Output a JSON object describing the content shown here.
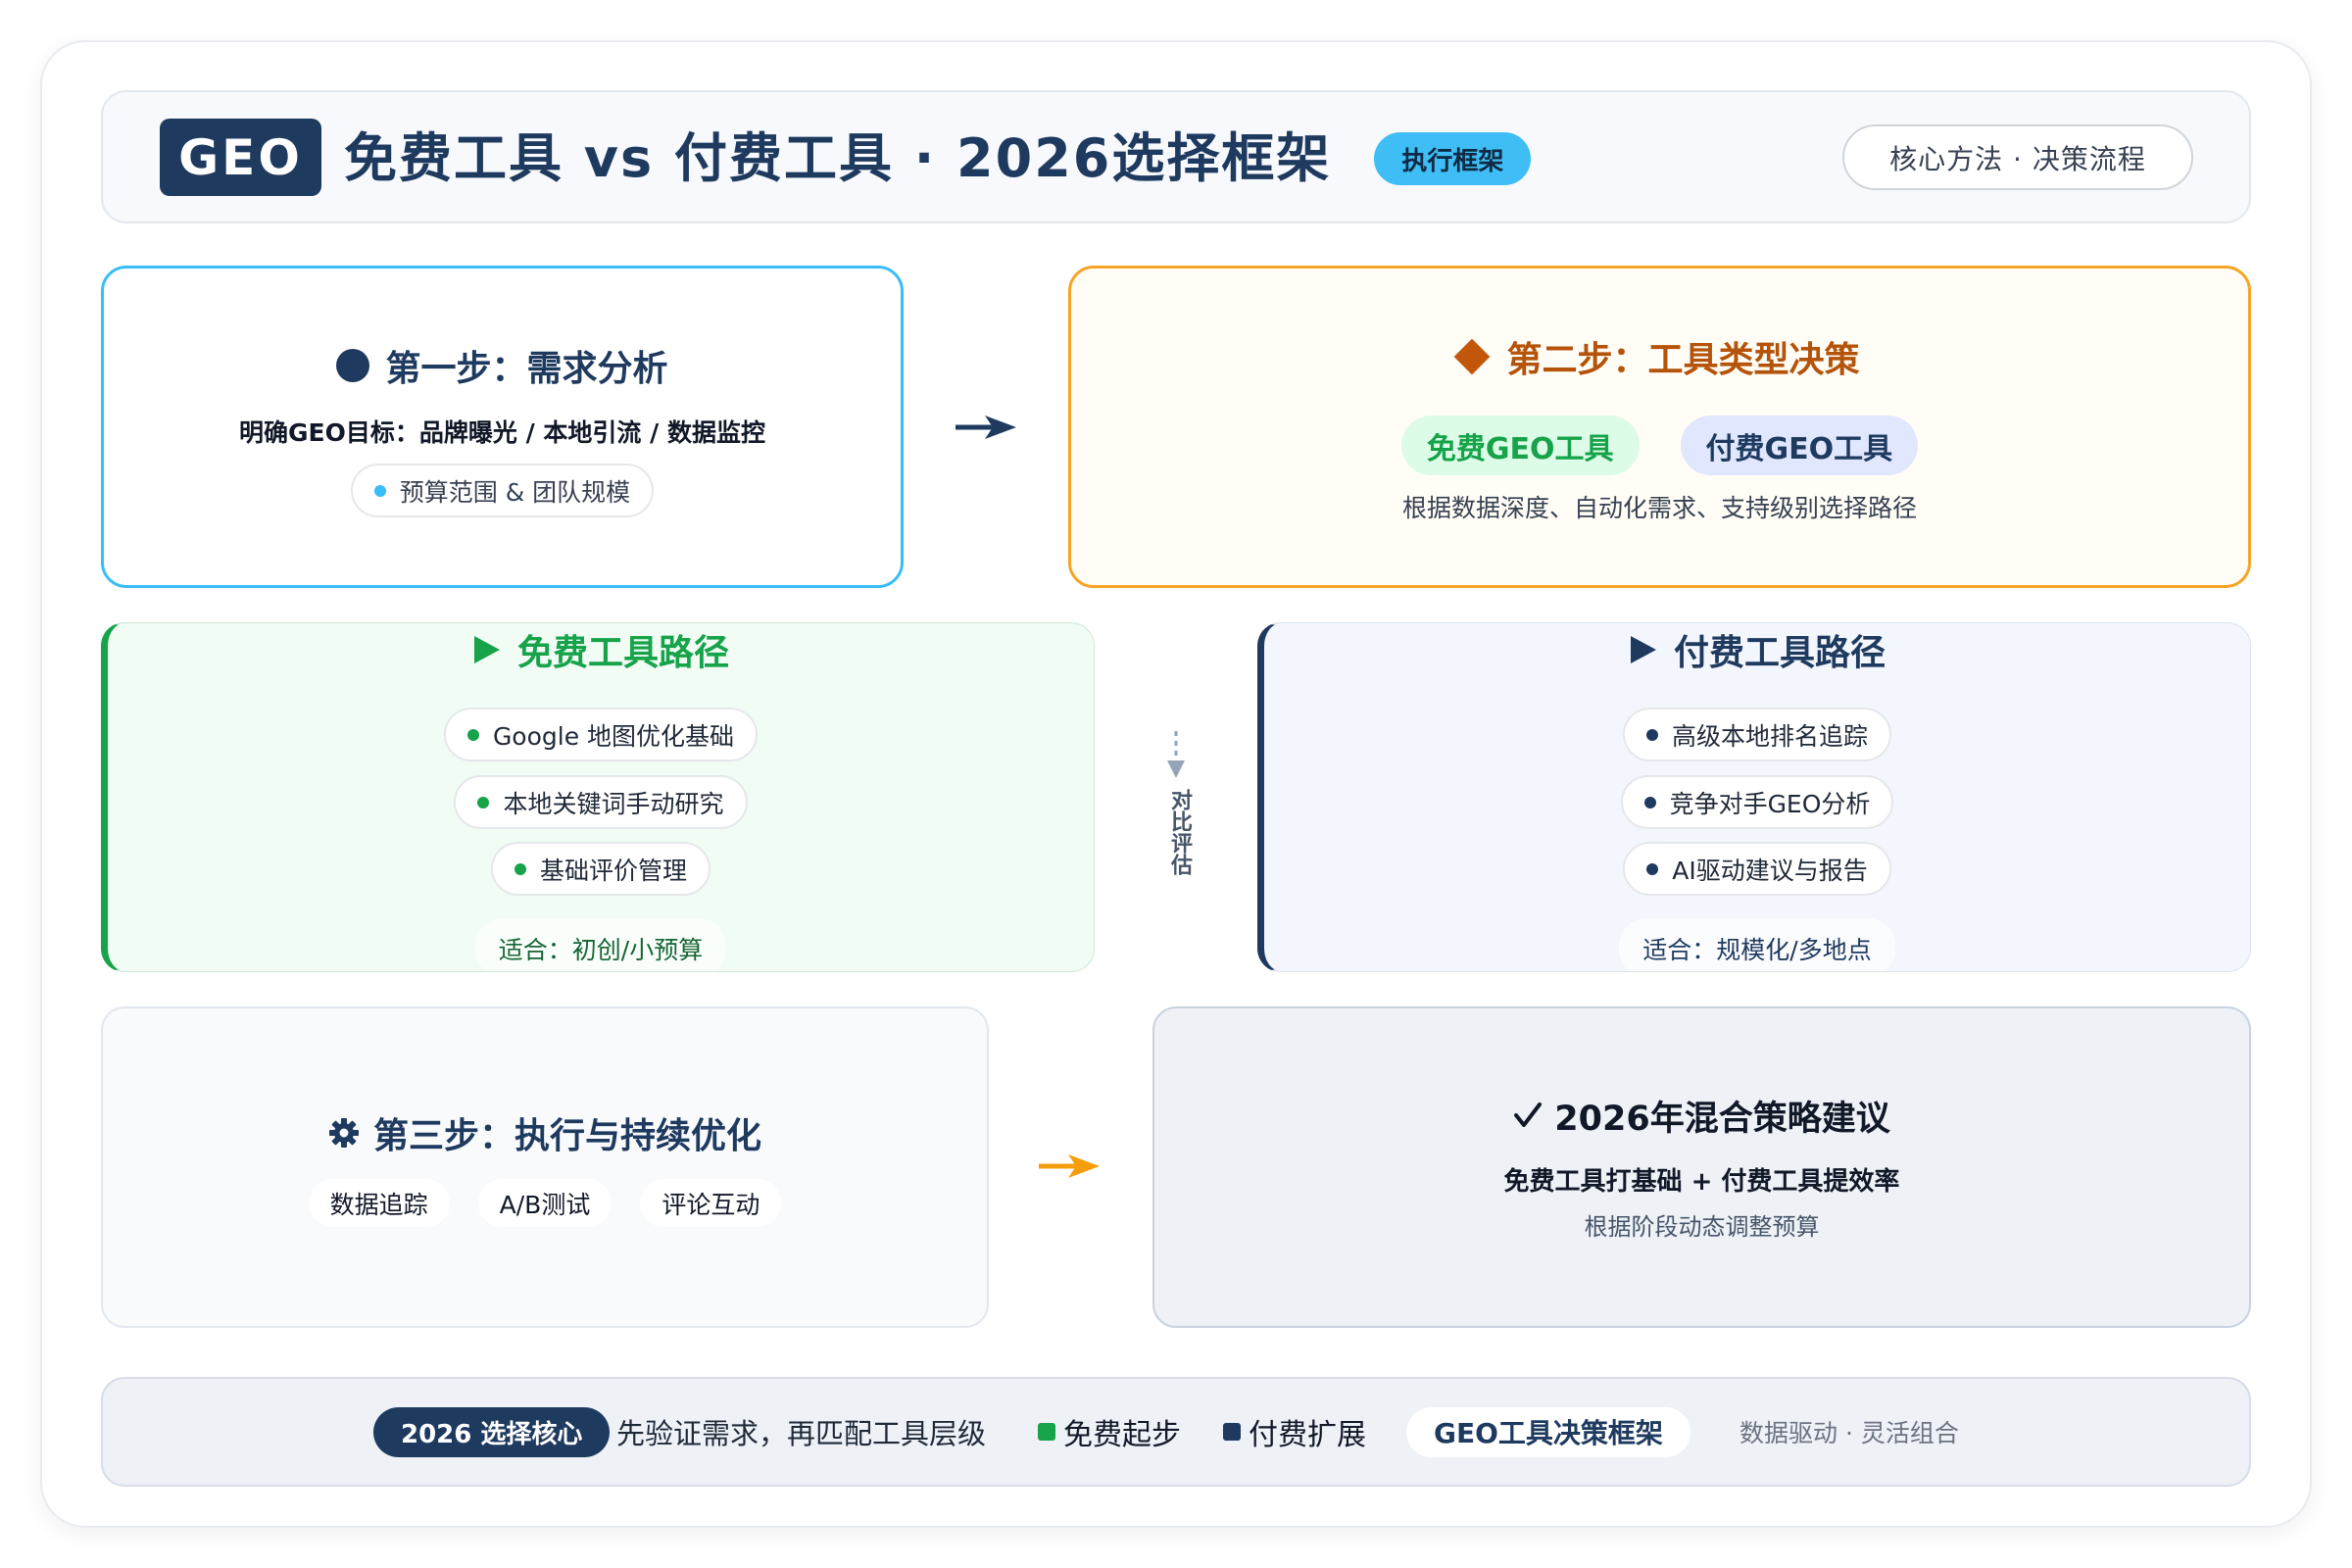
{
  "header": {
    "badge": "GEO",
    "title": "免费工具 vs 付费工具 · 2026选择框架",
    "tag": "执行框架",
    "right_pill": "核心方法 · 决策流程"
  },
  "step1": {
    "icon": "circle-icon",
    "title": "第一步：需求分析",
    "goal": "明确GEO目标：品牌曝光 / 本地引流 / 数据监控",
    "pill": "预算范围 & 团队规模"
  },
  "step2": {
    "icon": "diamond-icon",
    "title": "第二步：工具类型决策",
    "free_pill": "免费GEO工具",
    "paid_pill": "付费GEO工具",
    "desc": "根据数据深度、自动化需求、支持级别选择路径"
  },
  "free_path": {
    "icon": "play-triangle-icon",
    "title": "免费工具路径",
    "items": [
      "Google 地图优化基础",
      "本地关键词手动研究",
      "基础评价管理"
    ],
    "fit": "适合：初创/小预算"
  },
  "compare": {
    "icon": "dashed-arrow-down-icon",
    "label": "对比评估"
  },
  "paid_path": {
    "icon": "play-triangle-icon",
    "title": "付费工具路径",
    "items": [
      "高级本地排名追踪",
      "竞争对手GEO分析",
      "AI驱动建议与报告"
    ],
    "fit": "适合：规模化/多地点"
  },
  "step3": {
    "icon": "gear-icon",
    "title": "第三步：执行与持续优化",
    "tags": [
      "数据追踪",
      "A/B测试",
      "评论互动"
    ]
  },
  "step4": {
    "icon": "check-icon",
    "title": "2026年混合策略建议",
    "line1": "免费工具打基础 + 付费工具提效率",
    "line2": "根据阶段动态调整预算"
  },
  "footer": {
    "core_pill": "2026 选择核心",
    "text": "先验证需求，再匹配工具层级",
    "legend": [
      {
        "label": "免费起步",
        "color": "#16a34a"
      },
      {
        "label": "付费扩展",
        "color": "#1f3a5f"
      }
    ],
    "framework_pill": "GEO工具决策框架",
    "right_text": "数据驱动 · 灵活组合"
  },
  "colors": {
    "navy": "#1f3a5f",
    "sky": "#38bdf8",
    "orange": "#f59e0b",
    "orange_text": "#b45309",
    "green": "#16a34a",
    "green_light": "#dcfce7",
    "indigo_light": "#e0e7ff"
  }
}
